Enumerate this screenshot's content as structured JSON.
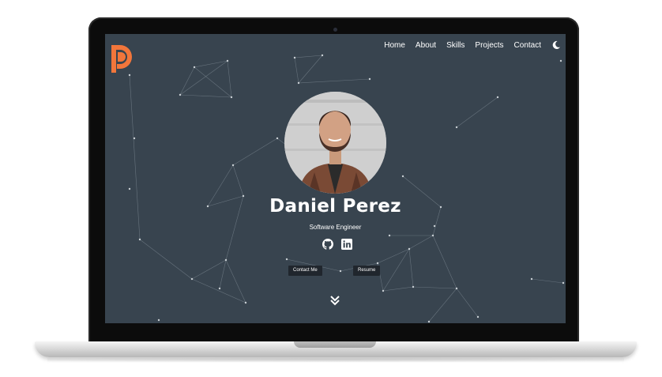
{
  "nav": {
    "items": [
      {
        "label": "Home"
      },
      {
        "label": "About"
      },
      {
        "label": "Skills"
      },
      {
        "label": "Projects"
      },
      {
        "label": "Contact"
      }
    ],
    "theme_toggle_icon": "moon-icon"
  },
  "logo": {
    "letters": "DP",
    "color": "#f2763b"
  },
  "hero": {
    "name": "Daniel Perez",
    "title": "Software Engineer",
    "social_icons": [
      "github-icon",
      "linkedin-icon"
    ],
    "buttons": {
      "contact": "Contact Me",
      "resume": "Resume"
    },
    "scroll_icon": "double-chevron-down-icon"
  },
  "colors": {
    "background": "#38444f",
    "accent": "#f2763b",
    "button": "#20262d",
    "text": "#ffffff"
  }
}
